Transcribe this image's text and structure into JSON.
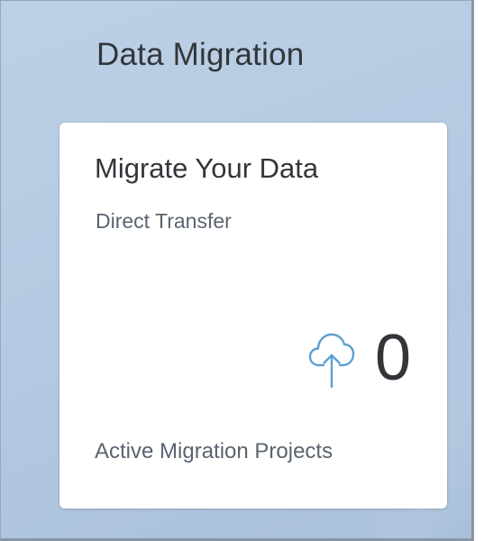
{
  "group": {
    "title": "Data Migration"
  },
  "tile": {
    "title": "Migrate Your Data",
    "subtitle": "Direct Transfer",
    "icon": "cloud-upload-icon",
    "icon_color": "#5e9fd1",
    "kpi_value": "0",
    "footer": "Active Migration Projects"
  }
}
